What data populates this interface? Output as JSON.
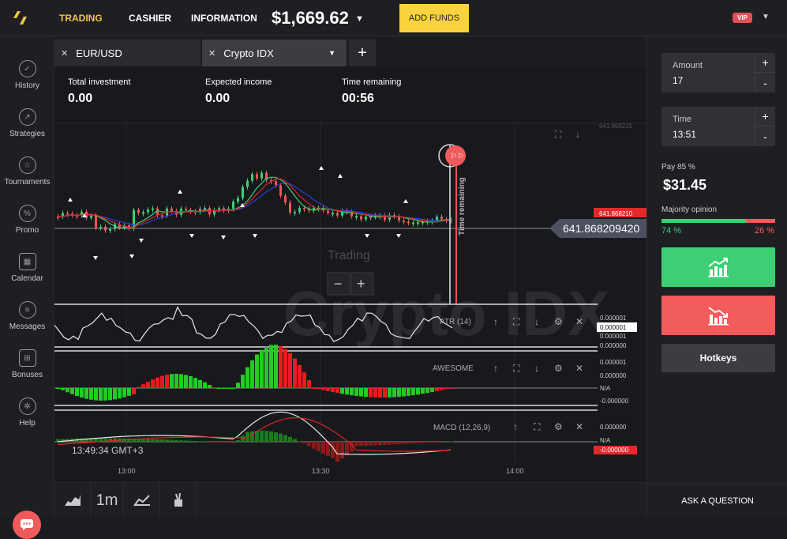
{
  "header": {
    "nav": [
      {
        "label": "TRADING",
        "active": true
      },
      {
        "label": "CASHIER",
        "active": false
      },
      {
        "label": "INFORMATION",
        "active": false
      }
    ],
    "balance": "$1,669.62",
    "add_funds": "ADD FUNDS",
    "vip": "VIP"
  },
  "sidebar": {
    "items": [
      {
        "label": "History",
        "icon": "history-icon"
      },
      {
        "label": "Strategies",
        "icon": "strategies-icon"
      },
      {
        "label": "Tournaments",
        "icon": "tournaments-icon"
      },
      {
        "label": "Promo",
        "icon": "promo-icon"
      },
      {
        "label": "Calendar",
        "icon": "calendar-icon"
      },
      {
        "label": "Messages",
        "icon": "messages-icon"
      },
      {
        "label": "Bonuses",
        "icon": "bonuses-icon"
      },
      {
        "label": "Help",
        "icon": "help-icon"
      }
    ]
  },
  "tabs": [
    {
      "label": "EUR/USD"
    },
    {
      "label": "Crypto IDX"
    }
  ],
  "stats": {
    "total_investment": {
      "label": "Total investment",
      "value": "0.00"
    },
    "expected_income": {
      "label": "Expected income",
      "value": "0.00"
    },
    "time_remaining": {
      "label": "Time remaining",
      "value": "00:56"
    }
  },
  "chart": {
    "watermark": "Crypto IDX",
    "trading_label": "Trading",
    "price_label": "641.868209420",
    "price_small": "641.868210",
    "top_axis_value": "641.868215",
    "time_remaining_vertical": "Time remaining",
    "current_time": "13:49:34 GMT+3",
    "x_ticks": [
      "13:00",
      "13:30",
      "14:00"
    ],
    "atr": {
      "label": "ATR (14)",
      "axis": [
        "0.000001",
        "0.000001",
        "0.000001",
        "0.000000"
      ]
    },
    "awesome": {
      "label": "AWESOME",
      "axis": [
        "0.000001",
        "0.000000",
        "N/A",
        "-0.000000"
      ]
    },
    "macd": {
      "label": "MACD (12,26,9)",
      "axis": [
        "0.000000",
        "N/A",
        "-0.000000"
      ]
    }
  },
  "right_panel": {
    "amount": {
      "label": "Amount",
      "value": "17"
    },
    "time": {
      "label": "Time",
      "value": "13:51"
    },
    "pay_label": "Pay 85 %",
    "payout": "$31.45",
    "majority_label": "Majority opinion",
    "majority_up": "74 %",
    "majority_down": "26 %",
    "majority_up_value": 74,
    "hotkeys": "Hotkeys",
    "ask": "ASK A QUESTION"
  },
  "bottom": {
    "timeframe": "1m"
  },
  "colors": {
    "accent": "#f9d33f",
    "up": "#3ecf74",
    "down": "#f35c5c"
  }
}
